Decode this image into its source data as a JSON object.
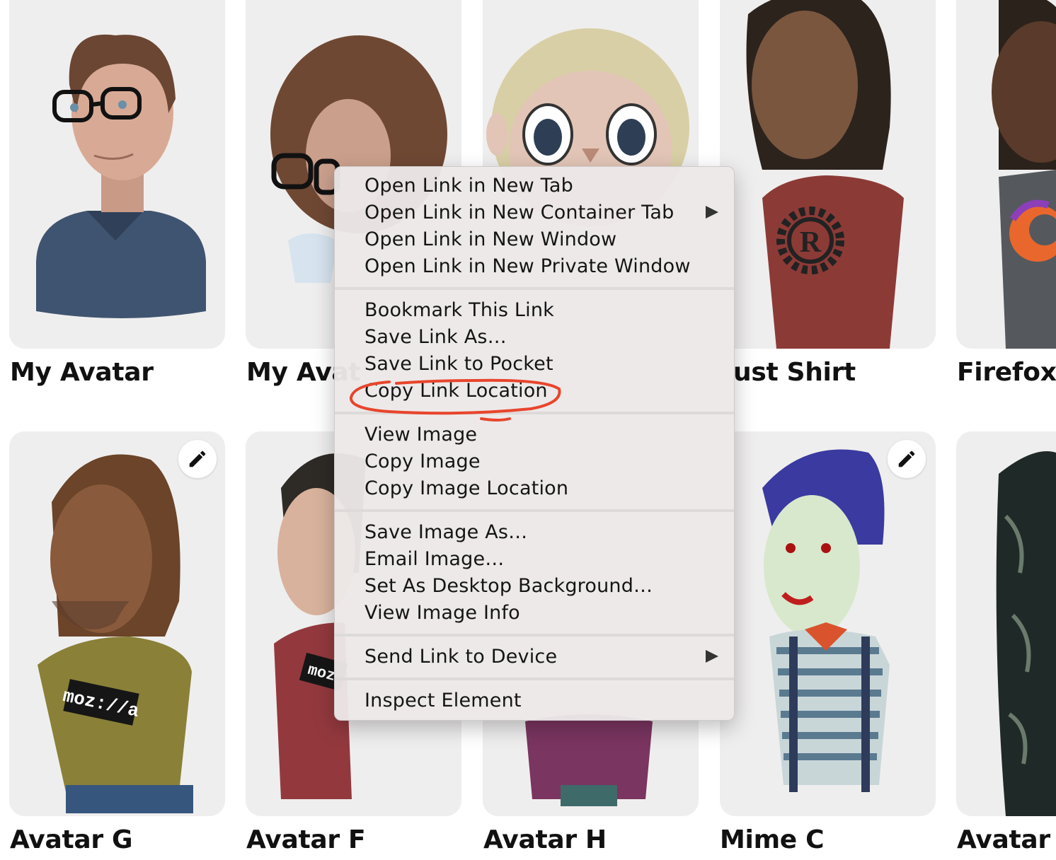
{
  "cards": [
    {
      "id": "my-avatar-1",
      "label": "My Avatar"
    },
    {
      "id": "my-avatar-2",
      "label": "My Avat"
    },
    {
      "id": "rust-shirt",
      "label": "ust Shirt"
    },
    {
      "id": "firefox",
      "label": "Firefox S"
    },
    {
      "id": "avatar-g",
      "label": "Avatar G"
    },
    {
      "id": "avatar-f",
      "label": "Avatar F"
    },
    {
      "id": "avatar-h",
      "label": "Avatar H"
    },
    {
      "id": "mime-c",
      "label": "Mime C"
    },
    {
      "id": "avatar-h2",
      "label": "Avatar H"
    }
  ],
  "context_menu": {
    "items": [
      {
        "label": "Open Link in New Tab"
      },
      {
        "label": "Open Link in New Container Tab",
        "submenu": true
      },
      {
        "label": "Open Link in New Window"
      },
      {
        "label": "Open Link in New Private Window"
      },
      {
        "label": "Bookmark This Link"
      },
      {
        "label": "Save Link As…"
      },
      {
        "label": "Save Link to Pocket"
      },
      {
        "label": "Copy Link Location",
        "highlighted_annotation": true
      },
      {
        "label": "View Image"
      },
      {
        "label": "Copy Image"
      },
      {
        "label": "Copy Image Location"
      },
      {
        "label": "Save Image As…"
      },
      {
        "label": "Email Image…"
      },
      {
        "label": "Set As Desktop Background…"
      },
      {
        "label": "View Image Info"
      },
      {
        "label": "Send Link to Device",
        "submenu": true
      },
      {
        "label": "Inspect Element"
      }
    ]
  },
  "shirt_texts": {
    "mozilla": "moz://a",
    "mozilla_partial": "moz"
  },
  "colors": {
    "annotation": "#e8452c",
    "card_bg": "#efeeee",
    "menu_bg": "#ece8e8"
  }
}
